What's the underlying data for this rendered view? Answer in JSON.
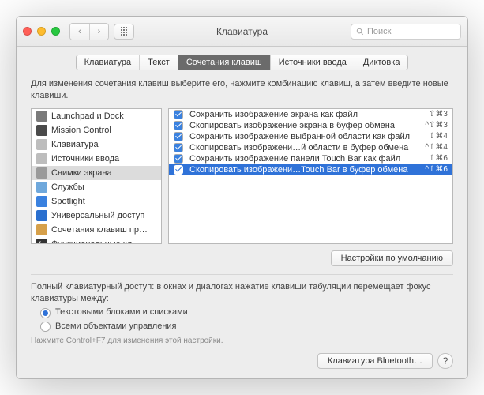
{
  "window": {
    "title": "Клавиатура"
  },
  "toolbar": {
    "search_placeholder": "Поиск"
  },
  "tabs": [
    {
      "label": "Клавиатура"
    },
    {
      "label": "Текст"
    },
    {
      "label": "Сочетания клавиш"
    },
    {
      "label": "Источники ввода"
    },
    {
      "label": "Диктовка"
    }
  ],
  "description": "Для изменения сочетания клавиш выберите его, нажмите комбинацию клавиш, а затем введите новые клавиши.",
  "categories": [
    {
      "label": "Launchpad и Dock",
      "icon_bg": "#7a7a7a"
    },
    {
      "label": "Mission Control",
      "icon_bg": "#4a4a4a"
    },
    {
      "label": "Клавиатура",
      "icon_bg": "#bdbdbd"
    },
    {
      "label": "Источники ввода",
      "icon_bg": "#bdbdbd"
    },
    {
      "label": "Снимки экрана",
      "icon_bg": "#9a9a9a"
    },
    {
      "label": "Службы",
      "icon_bg": "#6fa8dc"
    },
    {
      "label": "Spotlight",
      "icon_bg": "#3a81df"
    },
    {
      "label": "Универсальный доступ",
      "icon_bg": "#2a6fcf"
    },
    {
      "label": "Сочетания клавиш пр…",
      "icon_bg": "#d6a04a"
    },
    {
      "label": "Функциональные кл…",
      "icon_bg": "#333333",
      "icon_text": "fn"
    }
  ],
  "selected_category_index": 4,
  "shortcuts": [
    {
      "label": "Сохранить изображение экрана как файл",
      "keys": "⇧⌘3"
    },
    {
      "label": "Скопировать изображение экрана в буфер обмена",
      "keys": "^⇧⌘3"
    },
    {
      "label": "Сохранить изображение выбранной области как файл",
      "keys": "⇧⌘4"
    },
    {
      "label": "Скопировать изображени…й области в буфер обмена",
      "keys": "^⇧⌘4"
    },
    {
      "label": "Сохранить изображение панели Touch Bar как файл",
      "keys": "⇧⌘6"
    },
    {
      "label": "Скопировать изображени…Touch Bar в буфер обмена",
      "keys": "^⇧⌘6"
    }
  ],
  "selected_shortcut_index": 5,
  "defaults_button": "Настройки по умолчанию",
  "kbaccess": {
    "desc": "Полный клавиатурный доступ: в окнах и диалогах нажатие клавиши табуляции перемещает фокус клавиатуры между:",
    "option1": "Текстовыми блоками и списками",
    "option2": "Всеми объектами управления",
    "hint": "Нажмите Control+F7 для изменения этой настройки."
  },
  "bluetooth_button": "Клавиатура Bluetooth…"
}
